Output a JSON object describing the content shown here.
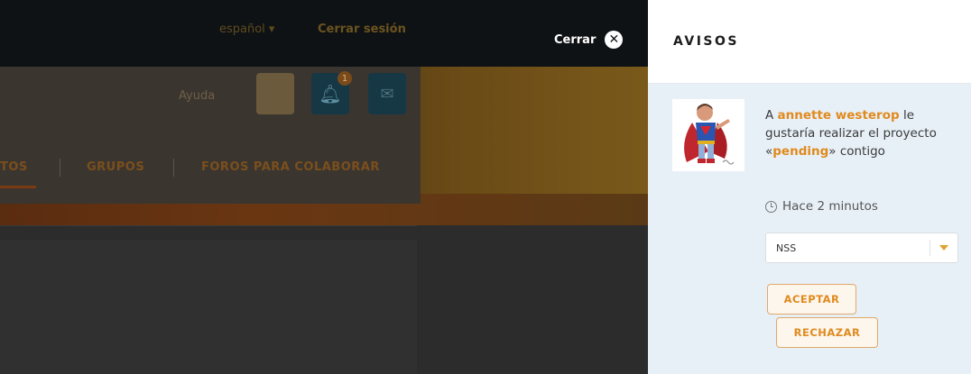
{
  "background": {
    "language": "español ▾",
    "logout": "Cerrar sesión",
    "close_label": "Cerrar",
    "help": "Ayuda",
    "notification_count": "1",
    "nav": [
      "TOS",
      "GRUPOS",
      "FOROS PARA COLABORAR"
    ]
  },
  "panel": {
    "title": "AVISOS",
    "notice": {
      "prefix": "A ",
      "user": "annette westerop",
      "middle": " le gustaría realizar el proyecto «",
      "project": "pending",
      "suffix": "» contigo",
      "time": "Hace 2 minutos",
      "select_value": "NSS",
      "accept_label": "ACEPTAR",
      "reject_label": "RECHAZAR"
    }
  },
  "colors": {
    "accent": "#e08a1e",
    "panel_bg": "#e8f0f7",
    "topbar": "#0f1215"
  },
  "icons": {
    "close": "close-icon",
    "bell": "bell-icon",
    "mail": "mail-icon",
    "clock": "clock-icon",
    "dropdown": "chevron-down-icon"
  }
}
